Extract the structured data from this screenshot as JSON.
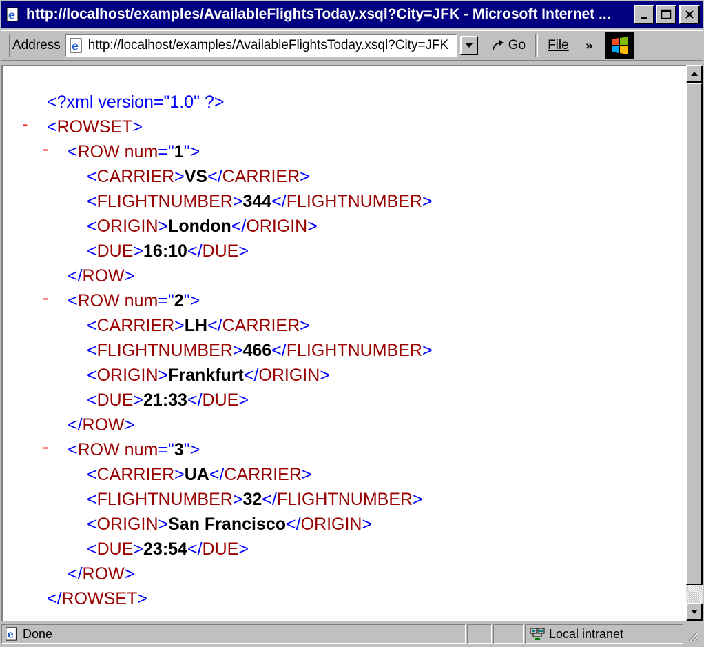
{
  "window": {
    "title": "http://localhost/examples/AvailableFlightsToday.xsql?City=JFK - Microsoft Internet ..."
  },
  "toolbar": {
    "address_label": "Address",
    "address_value": "http://localhost/examples/AvailableFlightsToday.xsql?City=JFK",
    "go_label": "Go",
    "file_menu": "File",
    "more_chevron": "»"
  },
  "xml": {
    "pi": "<?xml version=\"1.0\" ?>",
    "rowset_open": "ROWSET",
    "rowset_close": "ROWSET",
    "rows": [
      {
        "num": "1",
        "carrier": "VS",
        "flightnumber": "344",
        "flightnumber_close": "FLIGHTNUMBER",
        "origin": "London",
        "due": "16:10"
      },
      {
        "num": "2",
        "carrier": "LH",
        "flightnumber": "466",
        "flightnumber_close": "FLIGHTNUMBER",
        "origin": "Frankfurt",
        "due": "21:33"
      },
      {
        "num": "3",
        "carrier": "UA",
        "flightnumber": "32",
        "flightnumber_close": "FLIGHTNUMBER",
        "origin": "San Francisco",
        "due": "23:54"
      }
    ]
  },
  "status": {
    "text": "Done",
    "zone": "Local intranet"
  },
  "colors": {
    "titlebar": "#000080",
    "tag": "#0000ff",
    "tag_name": "#990000",
    "collapse_minus": "#ff0000"
  }
}
